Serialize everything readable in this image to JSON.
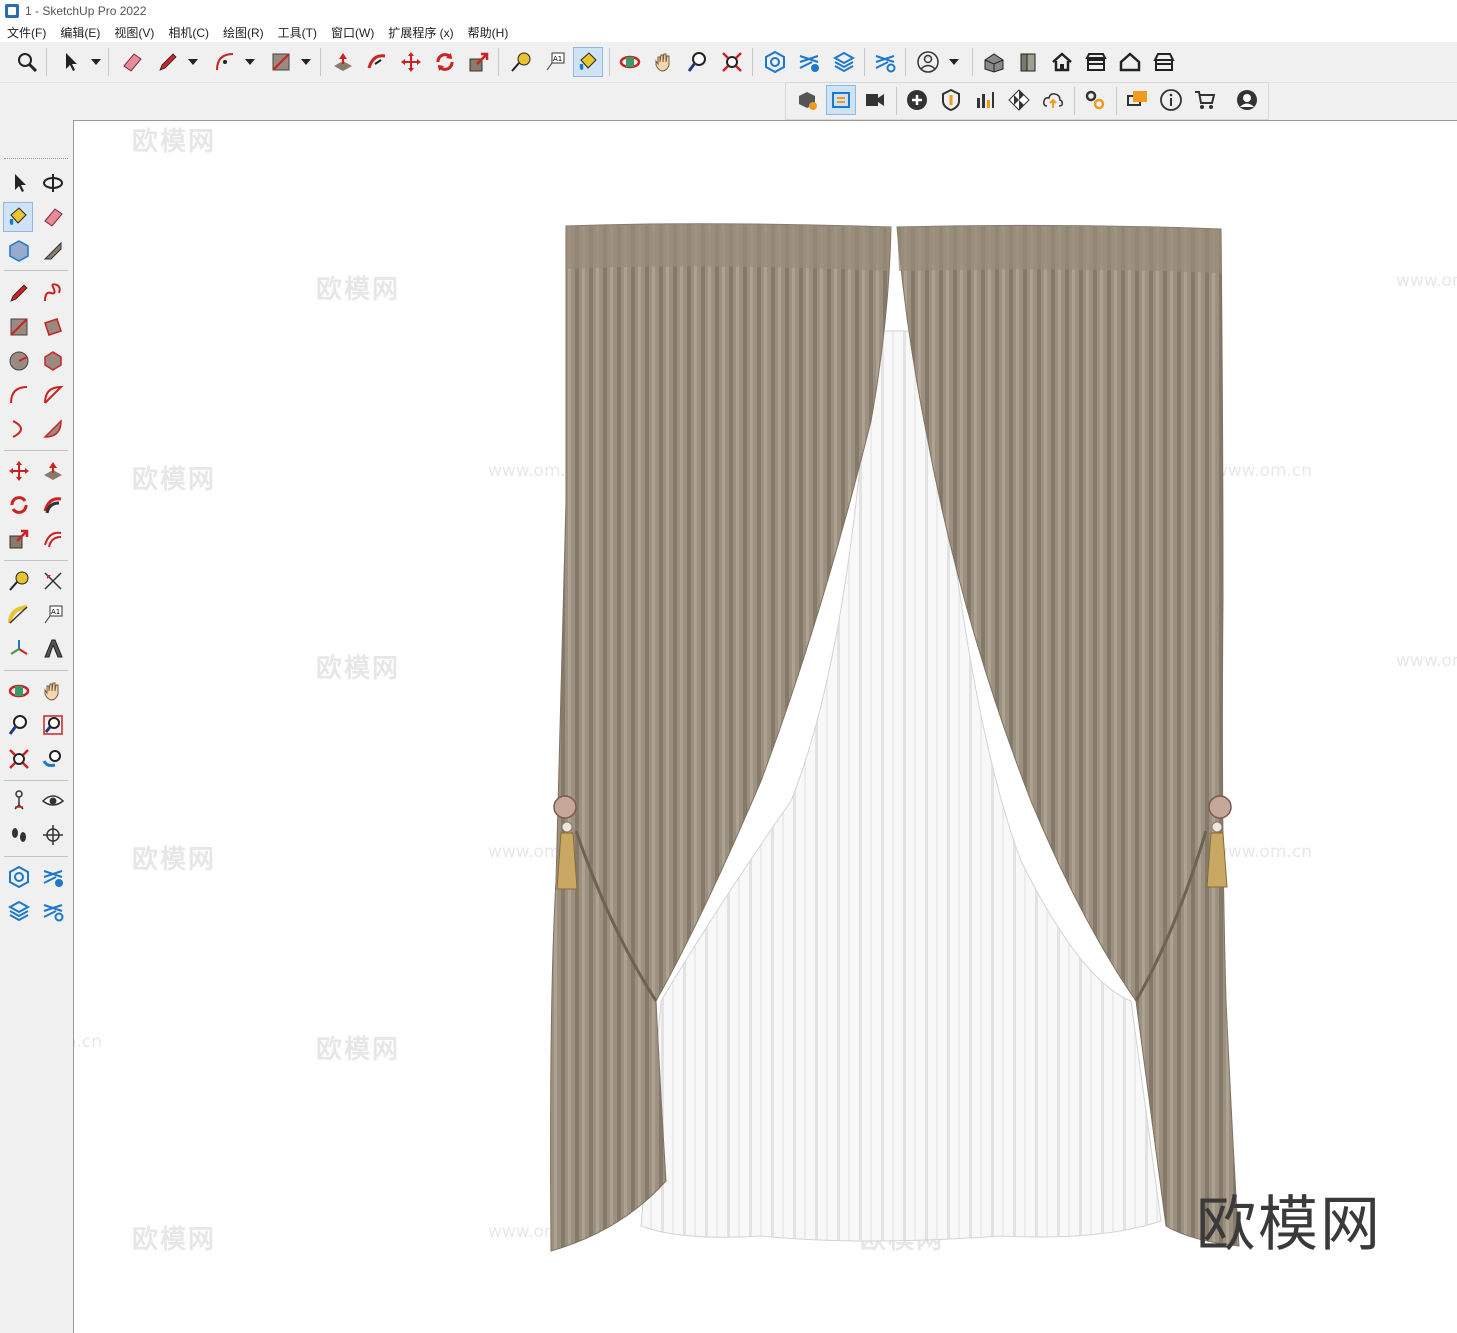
{
  "window": {
    "title": "1 - SketchUp Pro 2022"
  },
  "menu": {
    "items": [
      "文件(F)",
      "编辑(E)",
      "视图(V)",
      "相机(C)",
      "绘图(R)",
      "工具(T)",
      "窗口(W)",
      "扩展程序 (x)",
      "帮助(H)"
    ]
  },
  "colors": {
    "accent_blue": "#1e78c8",
    "tool_red": "#cc2222",
    "curtain_brown": "#9a8e7e",
    "sheer_white": "#f7f7f7",
    "tassel_gold": "#c9a864"
  },
  "icons": {
    "main_toolbar": [
      "zoom-icon",
      "select-icon",
      "eraser-icon",
      "pencil-icon",
      "arc-icon",
      "rectangle-icon",
      "push-pull-icon",
      "follow-me-icon",
      "move-icon",
      "rotate-icon",
      "scale-icon",
      "tape-measure-icon",
      "text-icon",
      "paint-bucket-icon",
      "orbit-icon",
      "pan-icon",
      "zoom-tool-icon",
      "zoom-extents-icon",
      "component-icon",
      "layers-icon",
      "stack-icon",
      "layers-settings-icon",
      "account-icon",
      "iso-view-icon",
      "front-view-icon",
      "home-view-icon",
      "top-view-icon",
      "house-view-icon",
      "garage-view-icon"
    ],
    "extension_toolbar": [
      "extension-warehouse-icon",
      "sync-icon",
      "video-icon",
      "add-circle-icon",
      "shield-icon",
      "chart-icon",
      "checker-icon",
      "cloud-upload-icon",
      "gear-icon",
      "chat-icon",
      "info-icon",
      "cart-icon",
      "user-icon"
    ]
  },
  "watermarks": {
    "cn": "欧模网",
    "url": "www.om.cn"
  },
  "brand": {
    "text": "欧模网"
  }
}
